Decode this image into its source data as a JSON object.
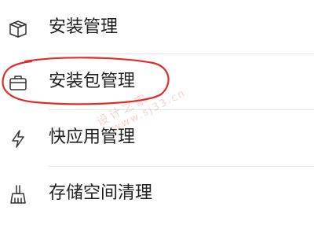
{
  "menu": {
    "items": [
      {
        "label": "安装管理",
        "icon": "box-icon"
      },
      {
        "label": "安装包管理",
        "icon": "briefcase-icon"
      },
      {
        "label": "快应用管理",
        "icon": "lightning-icon"
      },
      {
        "label": "存储空间清理",
        "icon": "broom-icon"
      }
    ]
  },
  "annotation": {
    "color": "#e02b2b"
  },
  "watermark": {
    "brand": "设计之家",
    "url": "www.sj33.cn"
  }
}
